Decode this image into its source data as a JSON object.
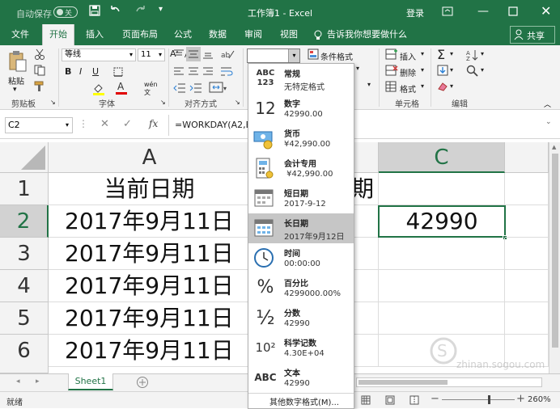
{
  "window": {
    "autosave_label": "自动保存",
    "autosave_state": "关",
    "title": "工作簿1 - Excel",
    "login_label": "登录"
  },
  "ribbon_tabs": [
    "文件",
    "开始",
    "插入",
    "页面布局",
    "公式",
    "数据",
    "审阅",
    "视图"
  ],
  "tell_me": "告诉我你想要做什么",
  "share_label": "共享",
  "ribbon": {
    "paste_label": "粘贴",
    "clipboard_group": "剪贴板",
    "font_name": "等线",
    "font_size": "11",
    "font_group": "字体",
    "align_group": "对齐方式",
    "cond_format": "条件格式",
    "insert": "插入",
    "delete": "删除",
    "format": "格式",
    "cells_group": "单元格",
    "editing_group": "编辑"
  },
  "formula_bar": {
    "name_box": "C2",
    "fx": "fx",
    "formula": "=WORKDAY(A2,B"
  },
  "grid": {
    "col_headers": [
      "A",
      "C"
    ],
    "row_headers": [
      "1",
      "2",
      "3",
      "4",
      "5",
      "6"
    ],
    "a_cells": [
      "当前日期",
      "2017年9月11日",
      "2017年9月11日",
      "2017年9月11日",
      "2017年9月11日",
      "2017年9月11日"
    ],
    "b1_partial": "期",
    "c2": "42990"
  },
  "number_formats": [
    {
      "name": "常规",
      "example": "无特定格式",
      "icon": "ABC 123"
    },
    {
      "name": "数字",
      "example": "42990.00",
      "icon": "12"
    },
    {
      "name": "货币",
      "example": "¥42,990.00",
      "icon": "currency-icon"
    },
    {
      "name": "会计专用",
      "example": " ¥42,990.00",
      "icon": "accounting-icon"
    },
    {
      "name": "短日期",
      "example": "2017-9-12",
      "icon": "calendar-icon"
    },
    {
      "name": "长日期",
      "example": "2017年9月12日",
      "icon": "calendar-icon"
    },
    {
      "name": "时间",
      "example": "00:00:00",
      "icon": "clock-icon"
    },
    {
      "name": "百分比",
      "example": "4299000.00%",
      "icon": "%"
    },
    {
      "name": "分数",
      "example": "42990",
      "icon": "½"
    },
    {
      "name": "科学记数",
      "example": "4.30E+04",
      "icon": "10²"
    },
    {
      "name": "文本",
      "example": "42990",
      "icon": "ABC"
    }
  ],
  "more_formats": "其他数字格式(M)...",
  "sheet_tab": "Sheet1",
  "status": {
    "ready": "就绪",
    "zoom": "260%"
  },
  "watermark": "zhinan.sogou.com",
  "colors": {
    "excel_green": "#217346",
    "ribbon_bg": "#f3f3f3",
    "selected_format": "#c6c6c6"
  }
}
